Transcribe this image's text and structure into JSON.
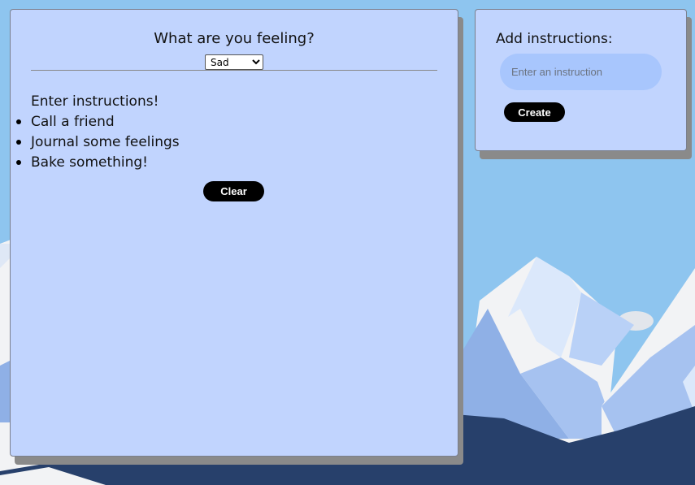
{
  "feeling_panel": {
    "title": "What are you feeling?",
    "selected_feeling": "Sad",
    "list_heading": "Enter instructions!",
    "instructions": [
      "Call a friend",
      "Journal some feelings",
      "Bake something!"
    ],
    "clear_label": "Clear"
  },
  "add_panel": {
    "title": "Add instructions:",
    "input_placeholder": "Enter an instruction",
    "create_label": "Create"
  },
  "colors": {
    "panel_bg": "#c1d4fe",
    "sky": "#8ec5ef",
    "button_bg": "#000000",
    "input_bg": "#a8c6fd"
  }
}
